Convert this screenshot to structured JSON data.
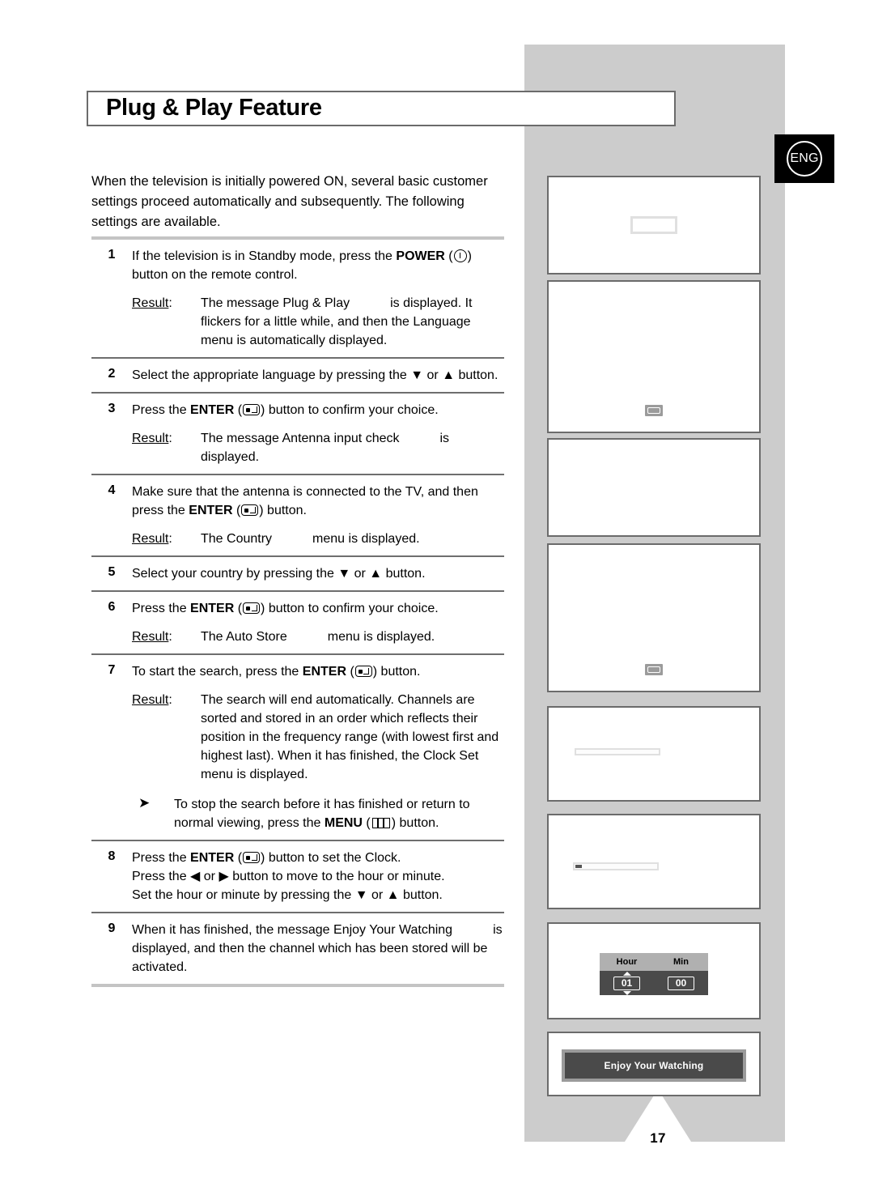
{
  "page": {
    "title": "Plug & Play Feature",
    "number": "17",
    "language_tab": "ENG",
    "intro": "When the television is initially powered ON, several basic customer settings proceed automatically and subsequently. The following settings are available."
  },
  "labels": {
    "result": "Result",
    "result_colon": ":"
  },
  "steps": [
    {
      "num": "1",
      "text_a": "If the television is in Standby mode, press the ",
      "bold": "POWER",
      "icon": "power-icon",
      "text_b": ") button on the remote control.",
      "result": "The message Plug & Play",
      "result_cont": "is displayed. It flickers for a little while, and then the Language menu is automatically displayed."
    },
    {
      "num": "2",
      "text": "Select the appropriate language by pressing the ▼ or ▲ button."
    },
    {
      "num": "3",
      "text_a": "Press the ",
      "bold": "ENTER",
      "icon": "enter-icon",
      "text_b": ") button to confirm your choice.",
      "result": "The message  Antenna input check",
      "result_cont": "is displayed."
    },
    {
      "num": "4",
      "text_a": "Make sure that the antenna is connected to the TV, and then press the ",
      "bold": "ENTER",
      "icon": "enter-icon",
      "text_b": ") button.",
      "result": "The  Country",
      "result_cont": "menu is displayed."
    },
    {
      "num": "5",
      "text": "Select your country by pressing the ▼ or ▲ button."
    },
    {
      "num": "6",
      "text_a": "Press the ",
      "bold": "ENTER",
      "icon": "enter-icon",
      "text_b": ") button to confirm your choice.",
      "result": "The Auto Store",
      "result_cont": "menu is displayed."
    },
    {
      "num": "7",
      "text_a": "To start the search, press the ",
      "bold": "ENTER",
      "icon": "enter-icon",
      "text_b": ") button.",
      "result": "The search will end automatically. Channels are sorted and stored in an order which reflects their position in the frequency range (with lowest first and highest last). When it has finished, the Clock Set menu is displayed.",
      "note_a": "To stop the search before it has finished or return to normal viewing, press the ",
      "note_bold": "MENU",
      "note_icon": "menu-icon",
      "note_b": ") button."
    },
    {
      "num": "8",
      "text_a": "Press the ",
      "bold": "ENTER",
      "icon": "enter-icon",
      "text_b": ") button to set the Clock.",
      "line2": "Press the ◀ or ▶ button to move to the hour or minute.",
      "line3": "Set the hour or minute by pressing the ▼ or ▲ button."
    },
    {
      "num": "9",
      "text": "When it has finished, the message  Enjoy Your Watching",
      "text_cont": "is displayed, and then the channel which has been stored will be activated."
    }
  ],
  "screenshots": [
    {
      "id": "language-menu",
      "content": "empty-box"
    },
    {
      "id": "antenna-input-check",
      "content": "enter-key-icon"
    },
    {
      "id": "country-menu",
      "content": "empty"
    },
    {
      "id": "auto-store-menu",
      "content": "enter-key-icon"
    },
    {
      "id": "auto-store-start",
      "content": "empty-bar"
    },
    {
      "id": "auto-store-progress",
      "content": "progress-bar"
    },
    {
      "id": "clock-set",
      "content": "clock-osd"
    },
    {
      "id": "enjoy-watching",
      "content": "banner"
    }
  ],
  "clock_osd": {
    "hour_label": "Hour",
    "min_label": "Min",
    "hour_value": "01",
    "min_value": "00"
  },
  "banner": {
    "text": "Enjoy Your Watching"
  },
  "colors": {
    "panel_grey": "#cccccc",
    "border_grey": "#6b6b6b",
    "rule_grey": "#c4c4c4",
    "rule_dark": "#6e6e6e",
    "osd_dark": "#4a4a4a",
    "osd_mid": "#9b9b9b",
    "osd_light": "#b0b0b0"
  }
}
